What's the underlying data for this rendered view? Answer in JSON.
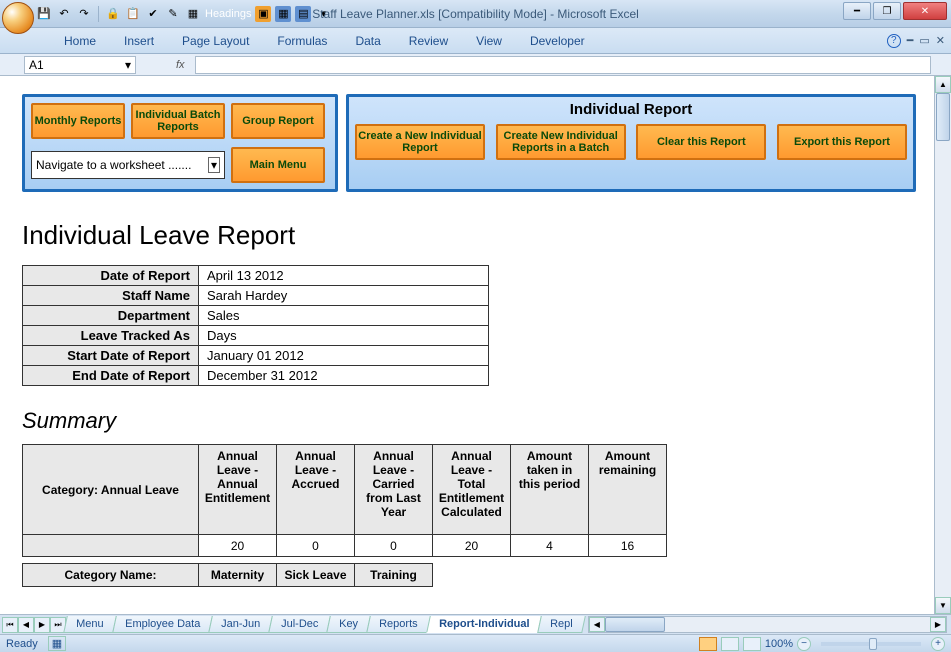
{
  "title": "Staff Leave Planner.xls  [Compatibility Mode] - Microsoft Excel",
  "qat_dropdown_label": "Headings",
  "ribbon": {
    "tabs": [
      "Home",
      "Insert",
      "Page Layout",
      "Formulas",
      "Data",
      "Review",
      "View",
      "Developer"
    ]
  },
  "name_box": "A1",
  "fx_label": "fx",
  "nav_panel": {
    "buttons": [
      "Monthly Reports",
      "Individual Batch Reports",
      "Group Report",
      "Main Menu"
    ],
    "dropdown": "Navigate to a worksheet ......."
  },
  "report_panel": {
    "title": "Individual Report",
    "buttons": [
      "Create a New Individual Report",
      "Create New Individual Reports in a Batch",
      "Clear this Report",
      "Export this Report"
    ]
  },
  "report_heading": "Individual Leave Report",
  "info": [
    {
      "label": "Date of Report",
      "value": "April 13 2012"
    },
    {
      "label": "Staff Name",
      "value": "Sarah Hardey"
    },
    {
      "label": "Department",
      "value": "Sales"
    },
    {
      "label": "Leave Tracked As",
      "value": "Days"
    },
    {
      "label": "Start Date of Report",
      "value": "January 01 2012"
    },
    {
      "label": "End Date of Report",
      "value": "December 31 2012"
    }
  ],
  "summary_heading": "Summary",
  "summary": {
    "category_label": "Category: Annual Leave",
    "columns": [
      "Annual Leave - Annual Entitlement",
      "Annual Leave - Accrued",
      "Annual Leave - Carried from Last Year",
      "Annual Leave - Total Entitlement Calculated",
      "Amount taken in this period",
      "Amount remaining"
    ],
    "values": [
      "20",
      "0",
      "0",
      "20",
      "4",
      "16"
    ]
  },
  "category2": {
    "label": "Category Name:",
    "cols": [
      "Maternity",
      "Sick Leave",
      "Training"
    ]
  },
  "sheet_tabs": [
    "Menu",
    "Employee Data",
    "Jan-Jun",
    "Jul-Dec",
    "Key",
    "Reports",
    "Report-Individual",
    "Repl"
  ],
  "active_tab_index": 6,
  "status": {
    "ready": "Ready",
    "zoom": "100%"
  }
}
